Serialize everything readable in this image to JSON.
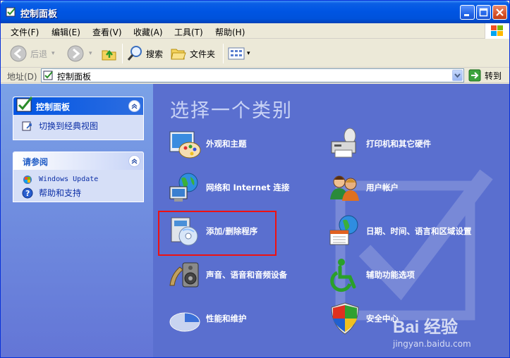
{
  "window": {
    "title": "控制面板",
    "title_icon": "control-panel-icon"
  },
  "menu": [
    "文件(F)",
    "编辑(E)",
    "查看(V)",
    "收藏(A)",
    "工具(T)",
    "帮助(H)"
  ],
  "toolbar": {
    "back": "后退",
    "search": "搜索",
    "folders": "文件夹"
  },
  "address": {
    "label": "地址(D)",
    "value": "控制面板",
    "go": "转到"
  },
  "sidebar": {
    "panel1": {
      "title": "控制面板",
      "links": [
        "切换到经典视图"
      ]
    },
    "panel2": {
      "title": "请参阅",
      "links": [
        "Windows Update",
        "帮助和支持"
      ]
    }
  },
  "main": {
    "heading": "选择一个类别",
    "categories": [
      {
        "label": "外观和主题",
        "icon": "appearance-icon"
      },
      {
        "label": "打印机和其它硬件",
        "icon": "printer-icon"
      },
      {
        "label": "网络和 Internet 连接",
        "icon": "network-icon"
      },
      {
        "label": "用户帐户",
        "icon": "user-accounts-icon"
      },
      {
        "label": "添加/删除程序",
        "icon": "add-remove-programs-icon"
      },
      {
        "label": "日期、时间、语言和区域设置",
        "icon": "date-time-icon"
      },
      {
        "label": "声音、语音和音频设备",
        "icon": "sound-icon"
      },
      {
        "label": "辅助功能选项",
        "icon": "accessibility-icon"
      },
      {
        "label": "性能和维护",
        "icon": "performance-icon"
      },
      {
        "label": "安全中心",
        "icon": "security-center-icon"
      }
    ]
  },
  "watermark": {
    "logo": "Bai 经验",
    "url": "jingyan.baidu.com"
  },
  "colors": {
    "titlebar": "#0055e3",
    "content_bg": "#5a6fcf",
    "highlight": "#ee1111"
  }
}
